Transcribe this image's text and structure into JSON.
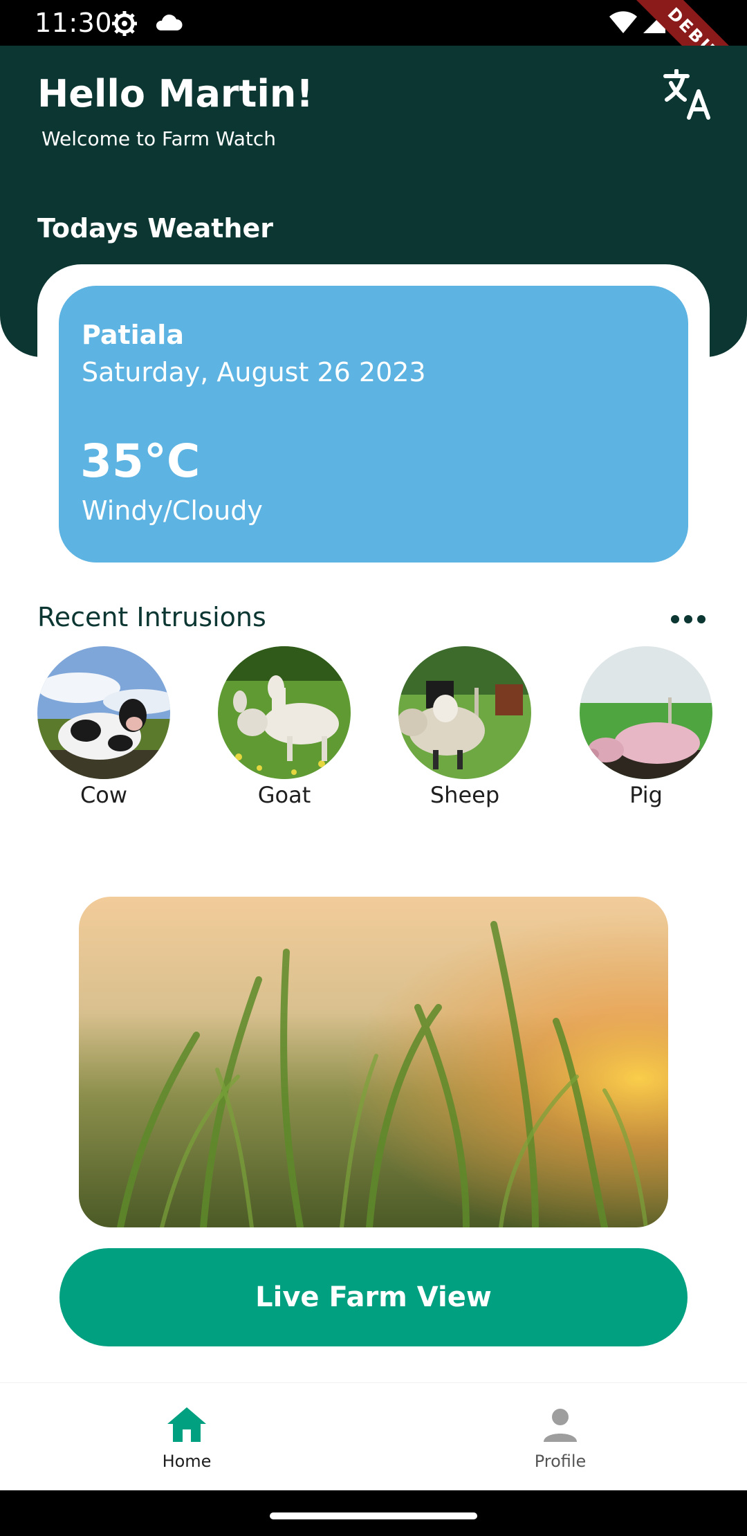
{
  "status_bar": {
    "time": "11:30",
    "icons": [
      "settings-icon",
      "cloud-icon",
      "wifi-icon",
      "signal-icon",
      "battery-icon"
    ],
    "debug_label": "DEBUG"
  },
  "header": {
    "greeting": "Hello Martin!",
    "subtitle": "Welcome to Farm Watch",
    "weather_title": "Todays Weather",
    "translate_icon": "translate-icon",
    "background_color": "#0b3631"
  },
  "weather": {
    "city": "Patiala",
    "date": "Saturday, August 26 2023",
    "temperature": "35°C",
    "condition": "Windy/Cloudy",
    "card_color": "#5db3e1"
  },
  "intrusions": {
    "title": "Recent Intrusions",
    "more_icon": "more-horizontal-icon",
    "animals": [
      {
        "label": "Cow"
      },
      {
        "label": "Goat"
      },
      {
        "label": "Sheep"
      },
      {
        "label": "Pig"
      }
    ]
  },
  "live_view": {
    "button_label": "Live Farm View",
    "button_color": "#00a081"
  },
  "bottom_nav": {
    "items": [
      {
        "label": "Home",
        "icon": "home-icon",
        "active": true
      },
      {
        "label": "Profile",
        "icon": "person-icon",
        "active": false
      }
    ],
    "active_color": "#00a081",
    "inactive_color": "#9e9e9e"
  }
}
